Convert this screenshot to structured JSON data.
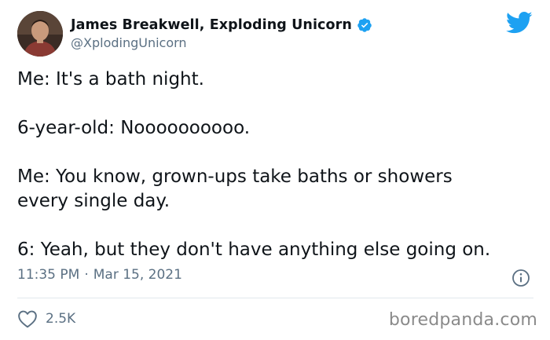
{
  "author": {
    "display_name": "James Breakwell, Exploding Unicorn",
    "handle": "@XplodingUnicorn",
    "verified": true,
    "avatar_icon": "author-avatar"
  },
  "tweet": {
    "paragraphs": [
      "Me: It's a bath night.",
      "6-year-old: Noooooooooo.",
      "Me: You know, grown-ups take baths or showers",
      "every single day.",
      "6: Yeah, but they don't have anything else going on."
    ],
    "time": "11:35 PM",
    "separator": "·",
    "date": "Mar 15, 2021"
  },
  "actions": {
    "like_count": "2.5K",
    "like_icon": "heart-icon",
    "info_icon": "info-icon"
  },
  "branding": {
    "platform_icon": "twitter-bird-icon",
    "watermark": "boredpanda.com"
  },
  "colors": {
    "twitter_blue": "#1da1f2",
    "secondary_text": "#5b7083",
    "primary_text": "#0f1419",
    "divider": "#e1e8ed"
  }
}
